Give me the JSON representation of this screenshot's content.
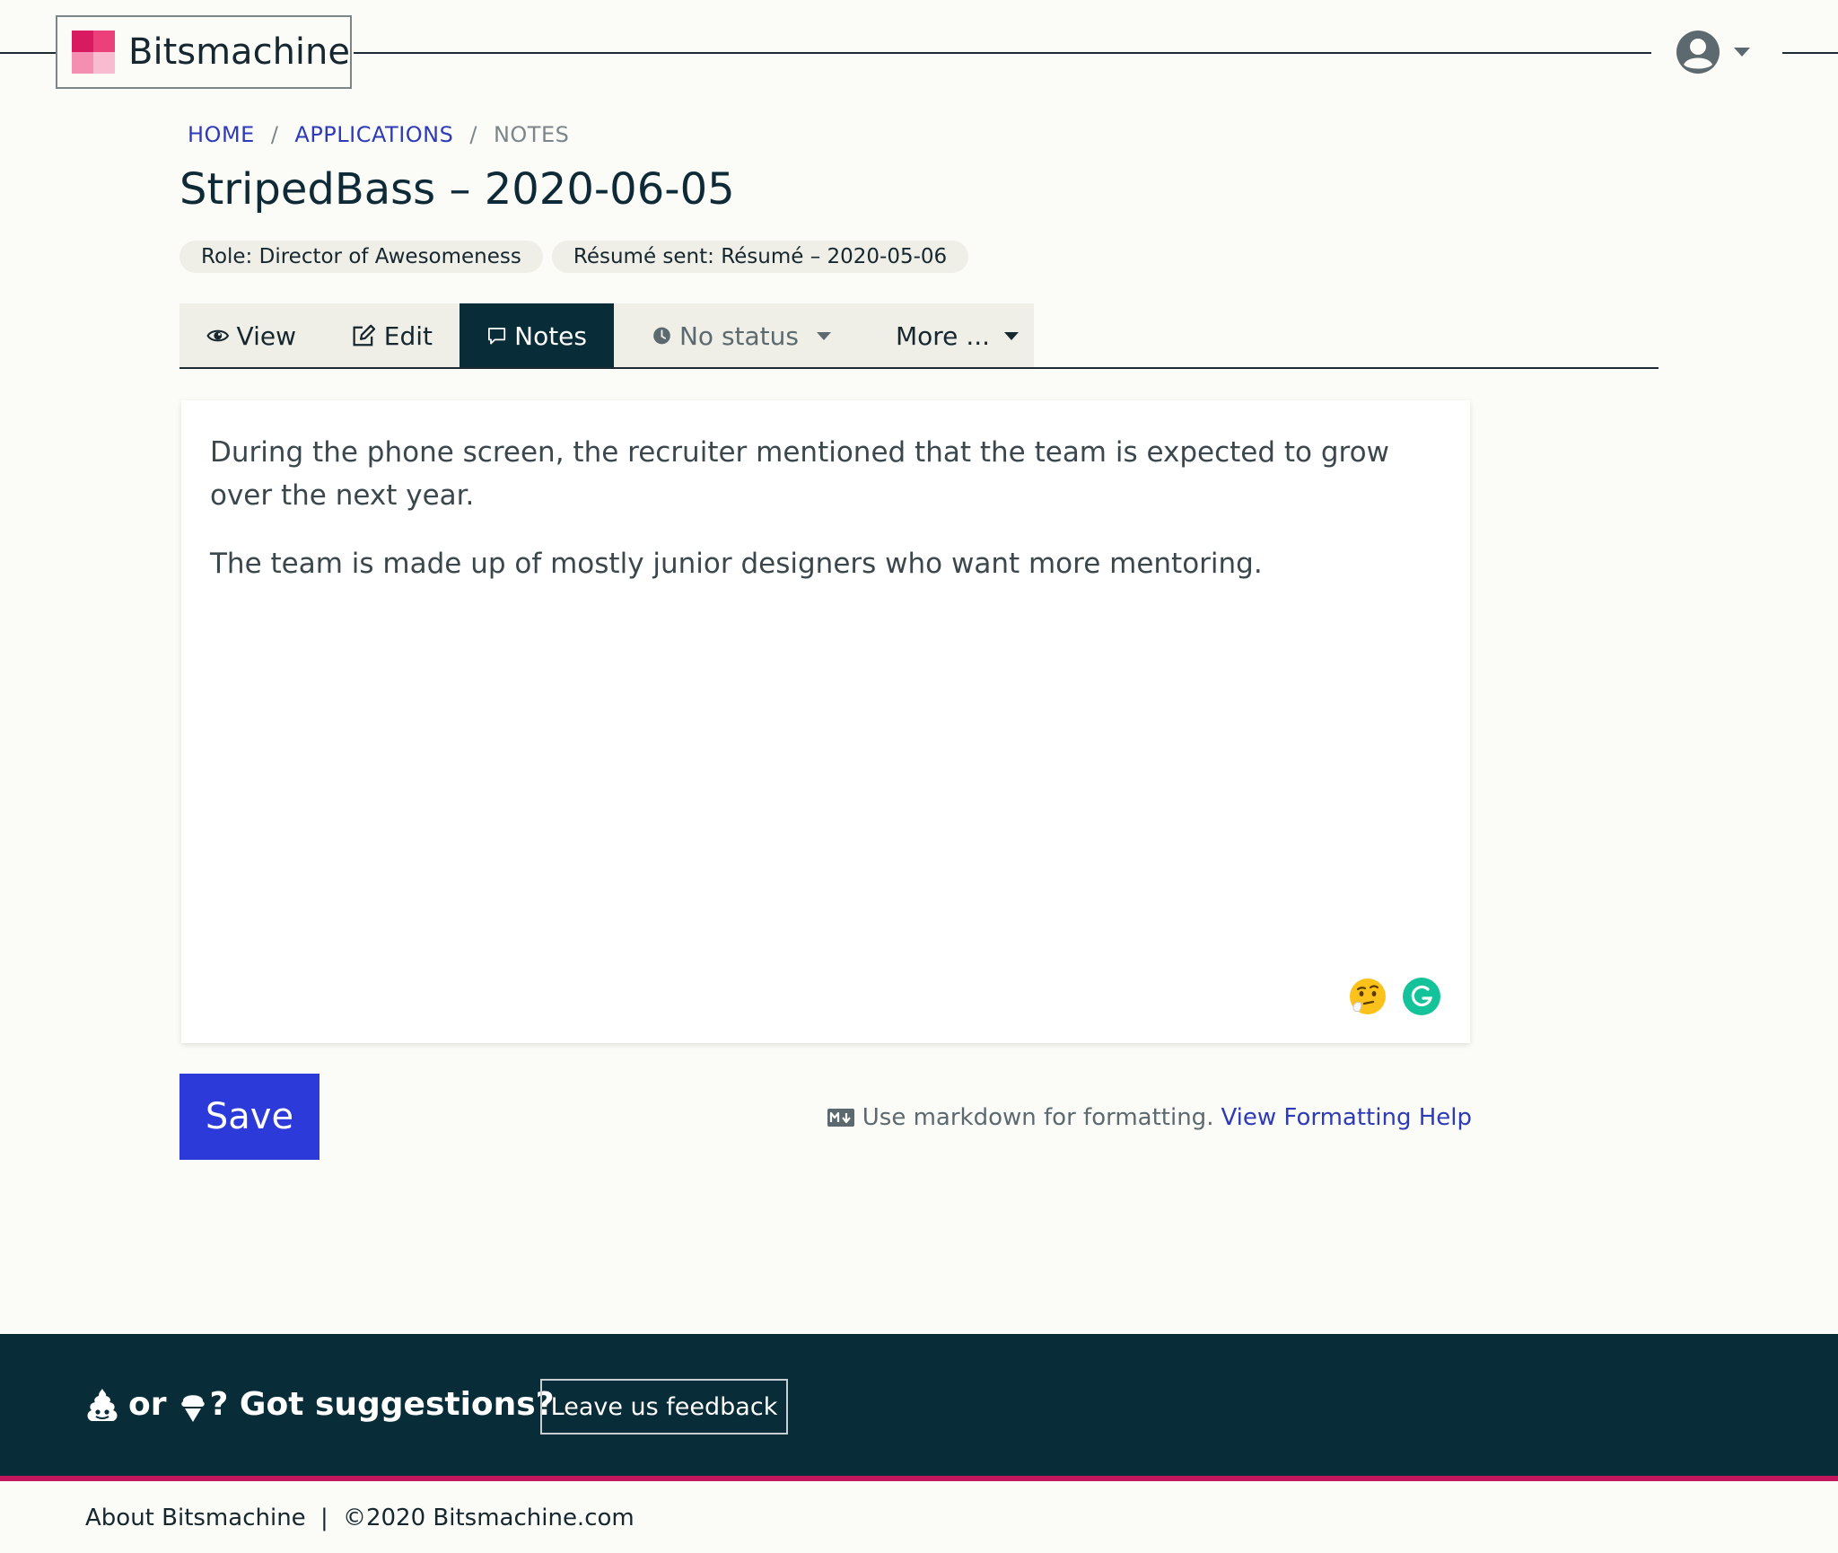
{
  "brand": {
    "name": "Bitsmachine",
    "colors": {
      "pink_dark": "#d81b60",
      "pink": "#ec407a",
      "pink_light": "#f48fb1",
      "pink_pale": "#f8bbd0"
    }
  },
  "header": {
    "user_icon": "user-circle-icon"
  },
  "breadcrumb": {
    "home": "HOME",
    "applications": "APPLICATIONS",
    "current": "NOTES",
    "separator": "/"
  },
  "page": {
    "title": "StripedBass – 2020-06-05",
    "chips": {
      "role": "Role: Director of Awesomeness",
      "resume": "Résumé sent: Résumé – 2020-05-06"
    }
  },
  "tabs": {
    "view": "View",
    "edit": "Edit",
    "notes": "Notes",
    "status": "No status",
    "more": "More ...",
    "active": "notes",
    "active_color": "#082c38"
  },
  "editor": {
    "paragraphs": [
      "During the phone screen, the recruiter mentioned that the team is expected to grow over the next year.",
      "The team is made up of mostly junior designers who want more mentoring."
    ]
  },
  "actions": {
    "save": "Save",
    "save_color": "#2b3ad8",
    "format_hint": "Use markdown for formatting.",
    "format_help_link": "View Formatting Help"
  },
  "footer": {
    "headline_or": "or",
    "headline_tail": "? Got suggestions?",
    "feedback_button": "Leave us feedback",
    "about_link": "About Bitsmachine",
    "bottom_separator": "|",
    "copyright": "©2020 Bitsmachine.com",
    "bg_color": "#082c38",
    "accent_color": "#c2185b"
  }
}
